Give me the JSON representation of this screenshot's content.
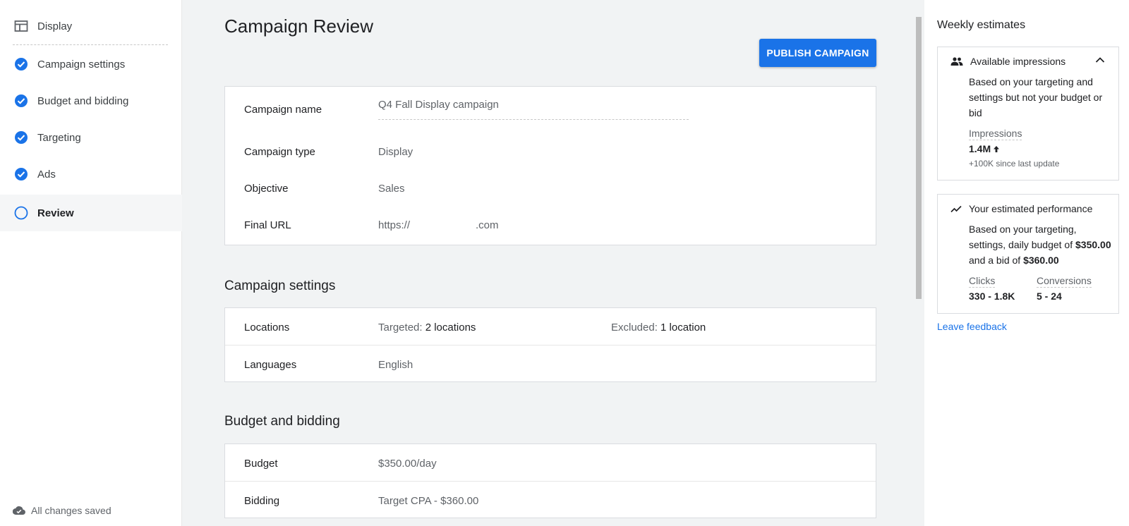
{
  "sidebar": {
    "items": [
      {
        "label": "Display",
        "icon": "display-layout-icon",
        "state": "type"
      },
      {
        "label": "Campaign settings",
        "icon": "check-circle-icon",
        "state": "done"
      },
      {
        "label": "Budget and bidding",
        "icon": "check-circle-icon",
        "state": "done"
      },
      {
        "label": "Targeting",
        "icon": "check-circle-icon",
        "state": "done"
      },
      {
        "label": "Ads",
        "icon": "check-circle-icon",
        "state": "done"
      },
      {
        "label": "Review",
        "icon": "empty-circle-icon",
        "state": "current"
      }
    ],
    "saved_status": "All changes saved"
  },
  "main": {
    "title": "Campaign Review",
    "publish_label": "PUBLISH CAMPAIGN",
    "summary": {
      "name_label": "Campaign name",
      "name_value": "Q4 Fall Display campaign",
      "type_label": "Campaign type",
      "type_value": "Display",
      "objective_label": "Objective",
      "objective_value": "Sales",
      "url_label": "Final URL",
      "url_prefix": "https://",
      "url_suffix": ".com"
    },
    "campaign_settings": {
      "title": "Campaign settings",
      "locations_label": "Locations",
      "targeted_label": "Targeted:",
      "targeted_value": "2 locations",
      "excluded_label": "Excluded:",
      "excluded_value": "1 location",
      "languages_label": "Languages",
      "languages_value": "English"
    },
    "budget_bidding": {
      "title": "Budget and bidding",
      "budget_label": "Budget",
      "budget_value": "$350.00/day",
      "bidding_label": "Bidding",
      "bidding_value": "Target CPA - $360.00"
    }
  },
  "estimates": {
    "title": "Weekly estimates",
    "impressions_card": {
      "heading": "Available impressions",
      "description": "Based on your targeting and settings but not your budget or bid",
      "metric_label": "Impressions",
      "metric_value": "1.4M",
      "change": "+100K since last update"
    },
    "performance_card": {
      "heading": "Your estimated performance",
      "desc_part1": "Based on your targeting, settings, daily budget of ",
      "budget": "$350.00",
      "desc_part2": " and a bid of ",
      "bid": "$360.00",
      "clicks_label": "Clicks",
      "clicks_value": "330 - 1.8K",
      "conversions_label": "Conversions",
      "conversions_value": "5 - 24"
    },
    "feedback_label": "Leave feedback"
  },
  "colors": {
    "accent": "#1a73e8",
    "main_bg": "#f1f3f4"
  }
}
